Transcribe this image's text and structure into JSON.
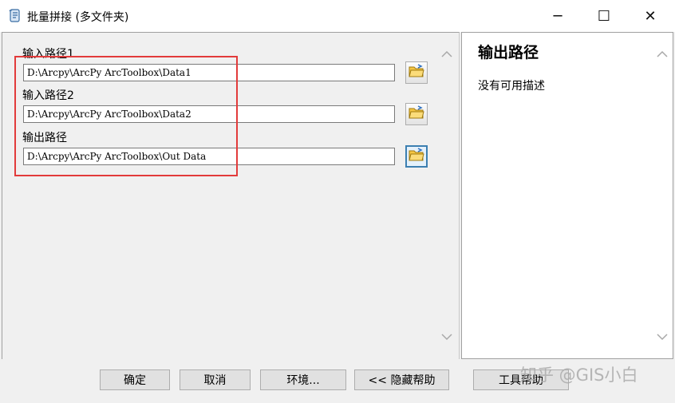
{
  "window": {
    "title": "批量拼接 (多文件夹)",
    "minimize_glyph": "─",
    "maximize_glyph": "☐",
    "close_glyph": "✕"
  },
  "form": {
    "fields": [
      {
        "label": "输入路径1",
        "value": "D:\\Arcpy\\ArcPy ArcToolbox\\Data1"
      },
      {
        "label": "输入路径2",
        "value": "D:\\Arcpy\\ArcPy ArcToolbox\\Data2"
      },
      {
        "label": "输出路径",
        "value": "D:\\Arcpy\\ArcPy ArcToolbox\\Out Data"
      }
    ]
  },
  "help": {
    "title": "输出路径",
    "description": "没有可用描述"
  },
  "buttons": {
    "ok": "确定",
    "cancel": "取消",
    "environments": "环境...",
    "hide_help": "<< 隐藏帮助",
    "tool_help": "工具帮助"
  },
  "watermark": "知乎 @GIS小白",
  "icons": {
    "title": "toolbox-script-icon",
    "browse": "open-folder-icon",
    "scroll_up": "scroll-up-icon",
    "scroll_down": "scroll-down-icon"
  },
  "colors": {
    "highlight_frame": "#e23b3b",
    "active_button_border": "#3c7fb1"
  }
}
